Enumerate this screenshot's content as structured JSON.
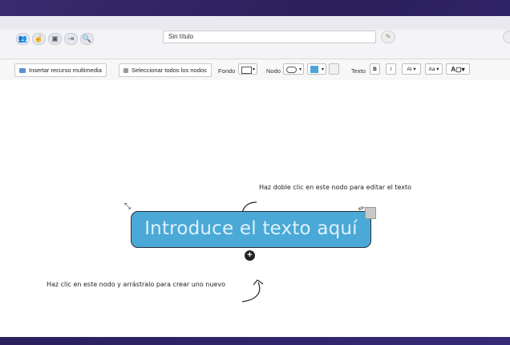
{
  "document": {
    "title": "Sin título"
  },
  "toolbar_top": {
    "icons": [
      "user-group-icon",
      "hand-pointer-icon",
      "image-icon",
      "import-icon",
      "zoom-icon"
    ],
    "brush_icon": "paint-brush-icon"
  },
  "toolbar_format": {
    "insert_media_label": "Insertar recurso multimedia",
    "select_all_label": "Seleccionar todos los nodos",
    "background_label": "Fondo",
    "node_label": "Nodo",
    "text_label": "Texto",
    "bold_label": "B",
    "italic_label": "I",
    "font_size_label": "AI",
    "font_case_label": "Aa",
    "font_color_label": "A",
    "node_fill_color": "#4aa6d8"
  },
  "canvas": {
    "node_text": "Introduce el texto aquí",
    "hint_edit": "Haz doble clic en este nodo para editar el texto",
    "hint_drag": "Haz clic en este nodo y arrástralo para crear uno nuevo",
    "node_color": "#4aa9d7"
  }
}
